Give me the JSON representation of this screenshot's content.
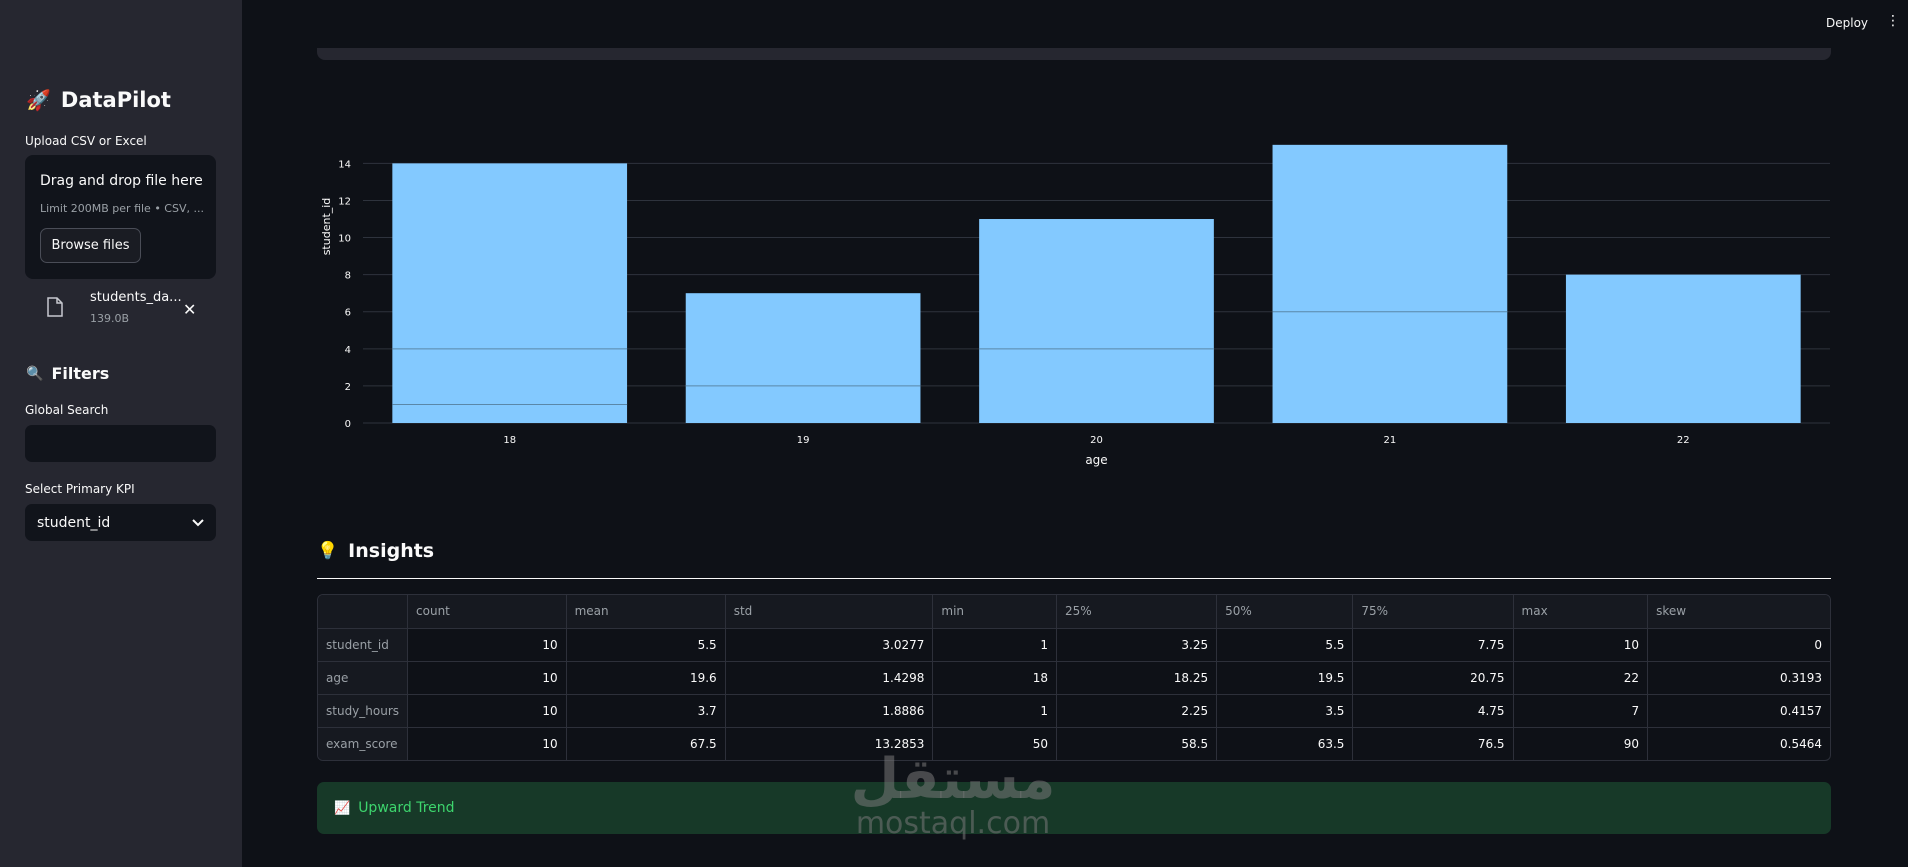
{
  "sidebar": {
    "brand": "DataPilot",
    "brand_icon": "rocket-icon",
    "upload_label": "Upload CSV or Excel",
    "dropzone_title": "Drag and drop file here",
    "dropzone_sub": "Limit 200MB per file • CSV, ...",
    "browse_label": "Browse files",
    "file_name": "students_da...",
    "file_size": "139.0B",
    "filters_title": "Filters",
    "filters_icon": "magnifier-icon",
    "global_search_label": "Global Search",
    "global_search_value": "",
    "kpi_label": "Select Primary KPI",
    "kpi_value": "student_id"
  },
  "header": {
    "deploy_label": "Deploy"
  },
  "chart_data": {
    "type": "bar",
    "categories": [
      "18",
      "19",
      "20",
      "21",
      "22"
    ],
    "values": [
      14,
      7,
      11,
      15,
      8
    ],
    "xlabel": "age",
    "ylabel": "student_id",
    "ylim": [
      0,
      15.8
    ],
    "yticks": [
      0,
      2,
      4,
      6,
      8,
      10,
      12,
      14
    ],
    "grid": true,
    "bar_color": "#83c9ff",
    "stack_lines": {
      "18": [
        1,
        4
      ],
      "19": [
        2
      ],
      "20": [
        4
      ],
      "21": [
        6
      ]
    }
  },
  "insights": {
    "title": "Insights",
    "icon": "lightbulb-icon",
    "columns": [
      "",
      "count",
      "mean",
      "std",
      "min",
      "25%",
      "50%",
      "75%",
      "max",
      "skew"
    ],
    "rows": [
      [
        "student_id",
        "10",
        "5.5",
        "3.0277",
        "1",
        "3.25",
        "5.5",
        "7.75",
        "10",
        "0"
      ],
      [
        "age",
        "10",
        "19.6",
        "1.4298",
        "18",
        "18.25",
        "19.5",
        "20.75",
        "22",
        "0.3193"
      ],
      [
        "study_hours",
        "10",
        "3.7",
        "1.8886",
        "1",
        "2.25",
        "3.5",
        "4.75",
        "7",
        "0.4157"
      ],
      [
        "exam_score",
        "10",
        "67.5",
        "13.2853",
        "50",
        "58.5",
        "63.5",
        "76.5",
        "90",
        "0.5464"
      ]
    ]
  },
  "trend": {
    "label": "Upward Trend",
    "icon": "chart-increasing-icon",
    "color": "#3dd56d"
  },
  "watermark": {
    "arabic": "مستقل",
    "latin": "mostaql.com"
  }
}
